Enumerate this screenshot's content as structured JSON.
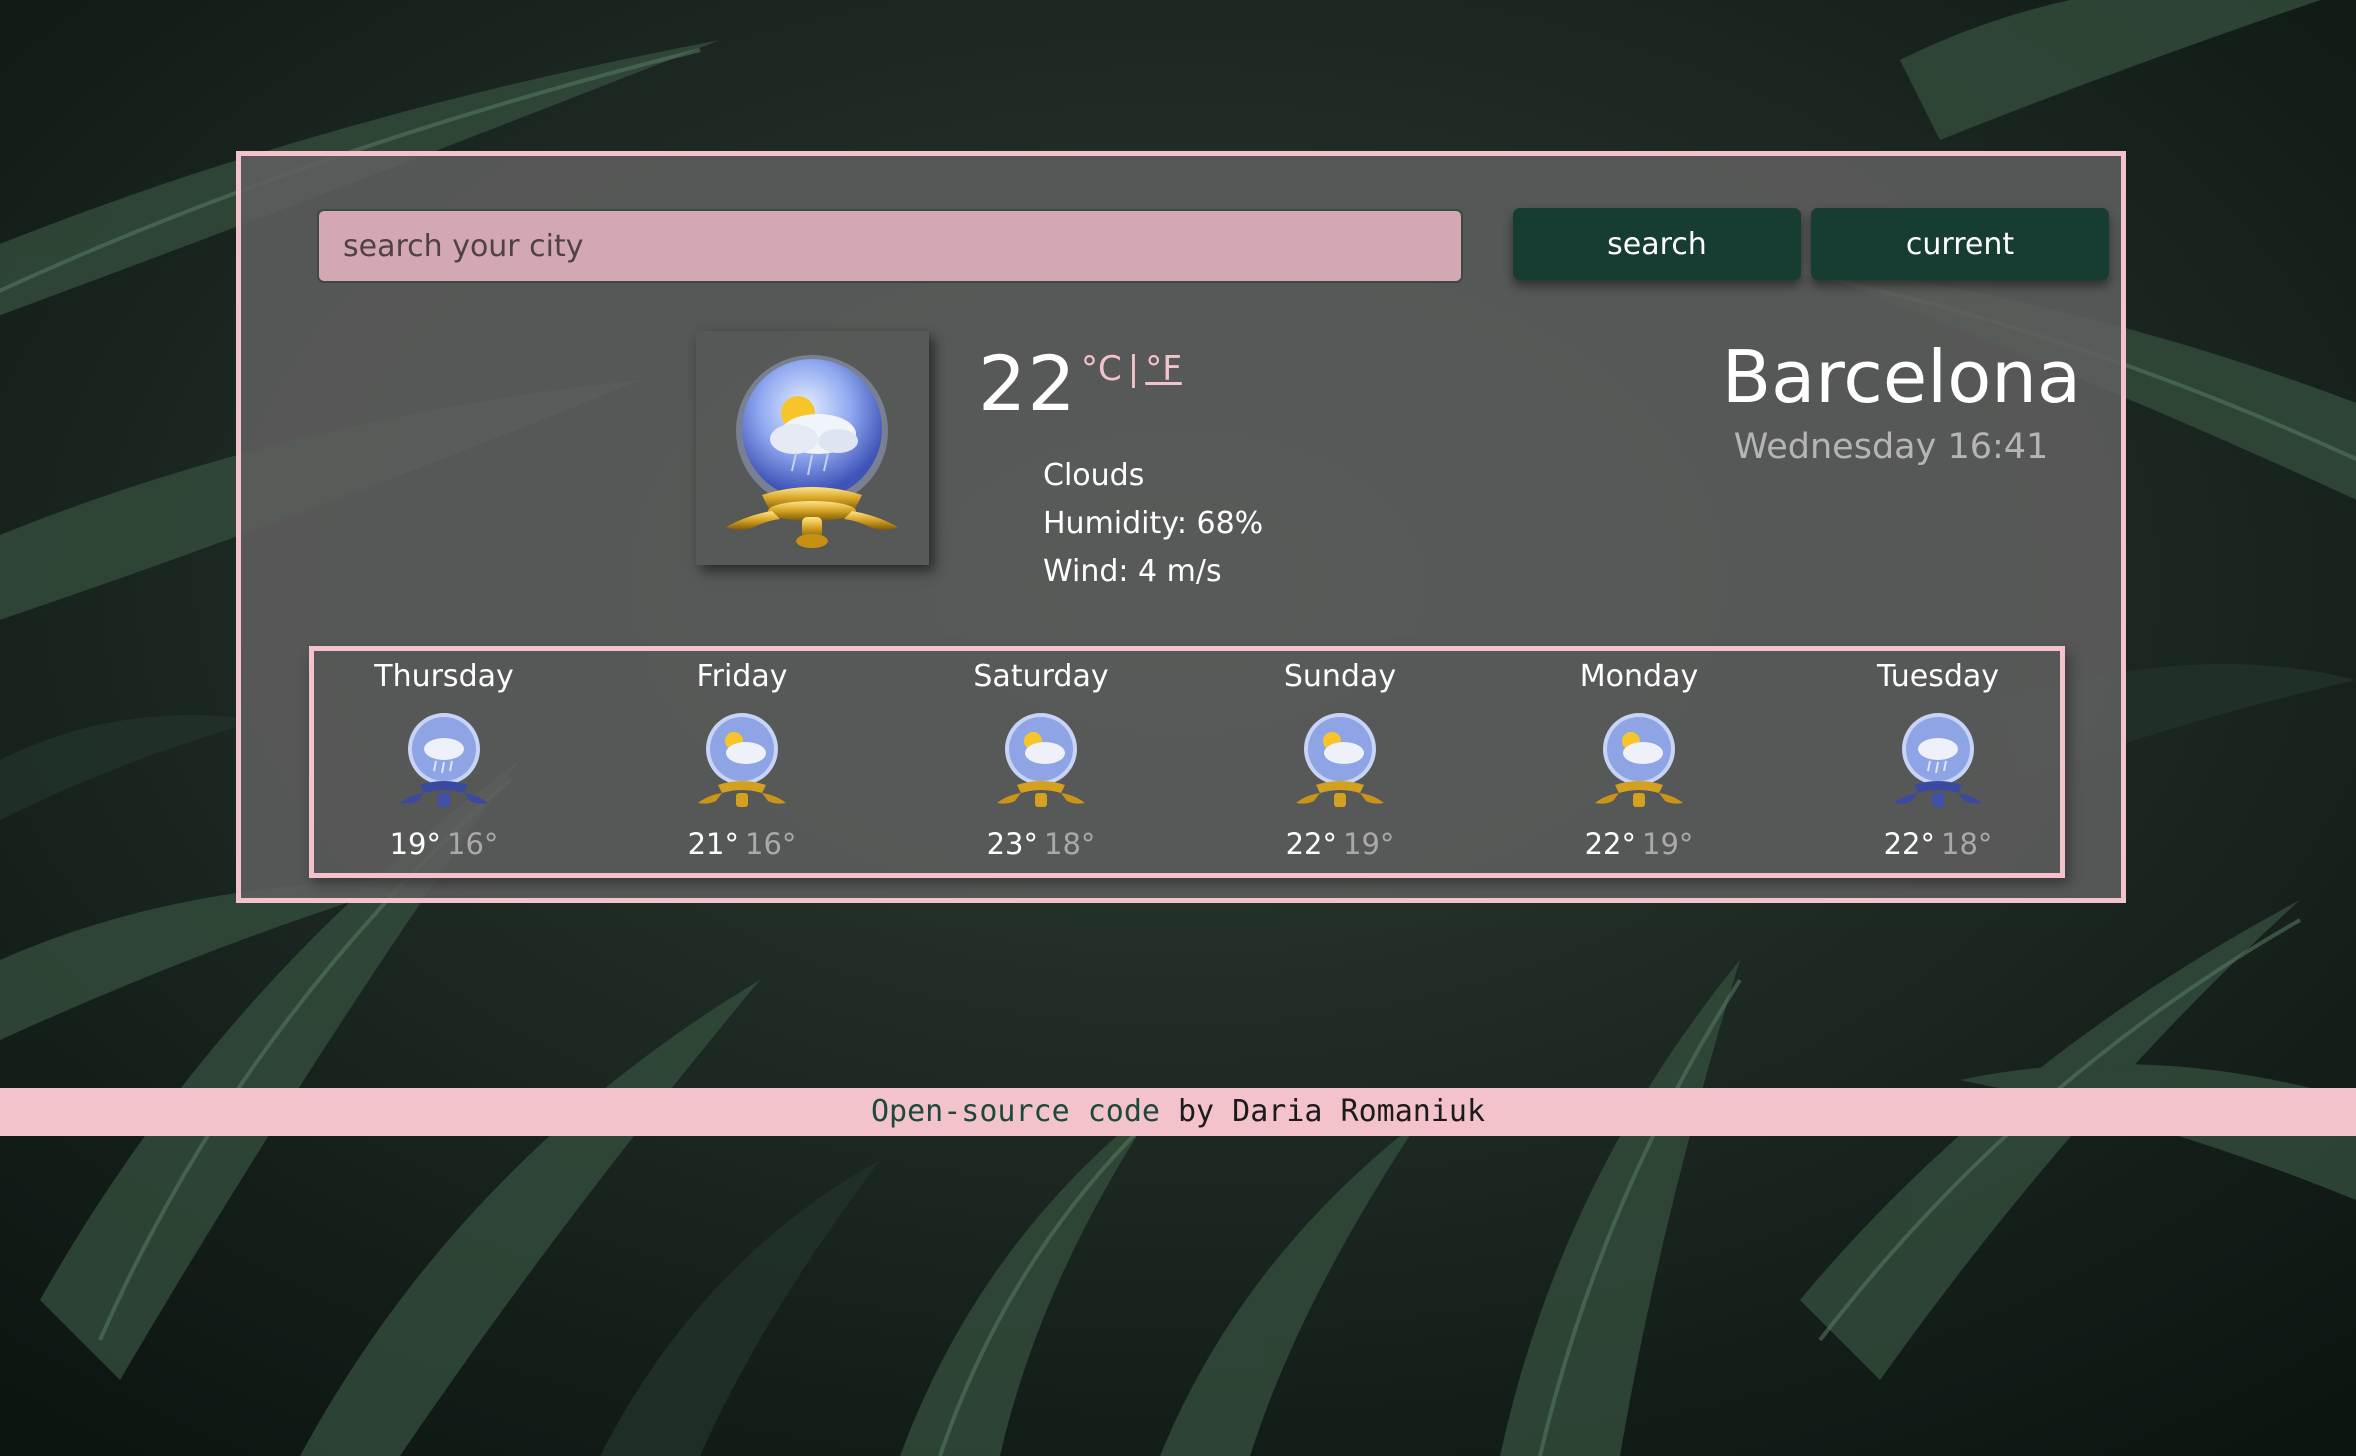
{
  "search": {
    "placeholder": "search your city",
    "search_label": "search",
    "current_label": "current"
  },
  "current": {
    "temperature": "22",
    "unit_c": "°C",
    "unit_sep": "|",
    "unit_f": "°F",
    "description": "Clouds",
    "humidity": "Humidity: 68%",
    "wind": "Wind: 4 m/s",
    "icon": "sun-cloud-rain-globe-icon"
  },
  "location": {
    "city": "Barcelona",
    "datetime": "Wednesday 16:41"
  },
  "forecast": [
    {
      "day": "Thursday",
      "max": "19°",
      "min": "16°",
      "icon": "cloud-rain-globe-icon"
    },
    {
      "day": "Friday",
      "max": "21°",
      "min": "16°",
      "icon": "sun-cloud-globe-icon"
    },
    {
      "day": "Saturday",
      "max": "23°",
      "min": "18°",
      "icon": "sun-cloud-globe-icon"
    },
    {
      "day": "Sunday",
      "max": "22°",
      "min": "19°",
      "icon": "sun-cloud-globe-icon"
    },
    {
      "day": "Monday",
      "max": "22°",
      "min": "19°",
      "icon": "sun-cloud-globe-icon"
    },
    {
      "day": "Tuesday",
      "max": "22°",
      "min": "18°",
      "icon": "cloud-rain-globe-icon"
    }
  ],
  "footer": {
    "link_text": "Open-source code",
    "by_text": " by Daria Romaniuk"
  },
  "colors": {
    "accent_pink": "#f4c2cb",
    "button_green": "#173d33",
    "panel_gray": "#5f605f"
  }
}
